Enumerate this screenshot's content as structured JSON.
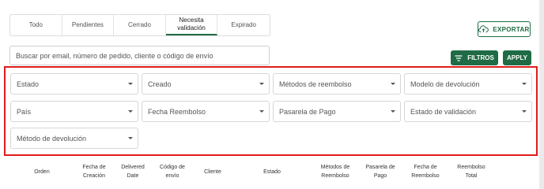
{
  "tabs": [
    {
      "label": "Todo",
      "active": false
    },
    {
      "label": "Pendientes",
      "active": false
    },
    {
      "label": "Cerrado",
      "active": false
    },
    {
      "label": "Necesita validación",
      "active": true
    },
    {
      "label": "Expirado",
      "active": false
    }
  ],
  "toolbar": {
    "export_label": "EXPORTAR",
    "search_placeholder": "Buscar por email, número de pedido, cliente o código de envío",
    "filters_label": "FILTROS",
    "apply_label": "APPLY"
  },
  "filters": [
    {
      "label": "Estado"
    },
    {
      "label": "Creado"
    },
    {
      "label": "Métodos de reembolso"
    },
    {
      "label": "Modelo de devolución"
    },
    {
      "label": "País"
    },
    {
      "label": "Fecha Reembolso"
    },
    {
      "label": "Pasarela de Pago"
    },
    {
      "label": "Estado de validación"
    },
    {
      "label": "Método de devolución"
    }
  ],
  "table": {
    "columns": [
      {
        "label": "Orden"
      },
      {
        "label": "Fecha de Creación"
      },
      {
        "label": "Delivered Date"
      },
      {
        "label": "Código de envío"
      },
      {
        "label": "Cliente"
      },
      {
        "label": "Estado"
      },
      {
        "label": "Métodos de Reembolso"
      },
      {
        "label": "Pasarela de Pago"
      },
      {
        "label": "Fecha de Reembolso"
      },
      {
        "label": "Reembolso Total"
      }
    ]
  },
  "colors": {
    "primary": "#1f6b45",
    "highlight": "#e01b1b"
  },
  "icons": {
    "export": "cloud-upload-icon",
    "filters": "filter-lines-icon",
    "dropdown": "caret-down-icon"
  }
}
